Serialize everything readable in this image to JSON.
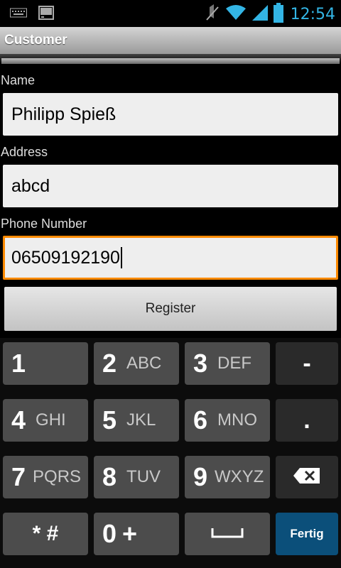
{
  "status_bar": {
    "time": "12:54",
    "icons": [
      "keyboard-icon",
      "terminal-icon",
      "mute-icon",
      "wifi-icon",
      "signal-icon",
      "battery-icon"
    ]
  },
  "title_bar": {
    "title": "Customer"
  },
  "form": {
    "name_label": "Name",
    "name_value": "Philipp Spieß",
    "address_label": "Address",
    "address_value": "abcd",
    "phone_label": "Phone Number",
    "phone_value": "06509192190",
    "register_label": "Register"
  },
  "keyboard": {
    "keys": [
      {
        "num": "1",
        "letters": ""
      },
      {
        "num": "2",
        "letters": "ABC"
      },
      {
        "num": "3",
        "letters": "DEF"
      },
      {
        "sym": "-"
      },
      {
        "num": "4",
        "letters": "GHI"
      },
      {
        "num": "5",
        "letters": "JKL"
      },
      {
        "num": "6",
        "letters": "MNO"
      },
      {
        "sym": "."
      },
      {
        "num": "7",
        "letters": "PQRS"
      },
      {
        "num": "8",
        "letters": "TUV"
      },
      {
        "num": "9",
        "letters": "WXYZ"
      },
      {
        "num": "0",
        "letters": "+"
      }
    ],
    "star_hash": "* #",
    "done_label": "Fertig"
  },
  "colors": {
    "accent": "#33b5e5",
    "focus": "#ff8a00",
    "done_key": "#0b4f7a"
  }
}
